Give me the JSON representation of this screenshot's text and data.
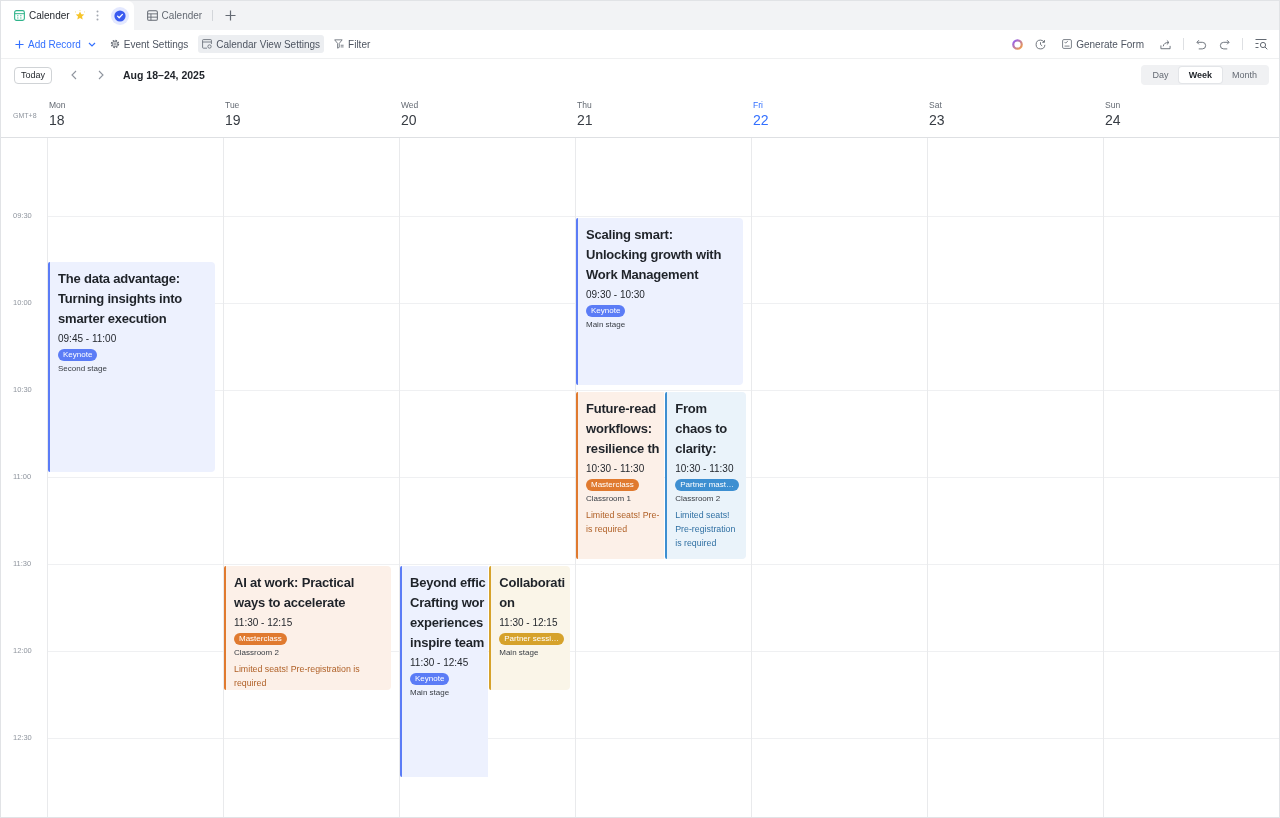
{
  "tabs": [
    {
      "label": "Calender",
      "kind": "calendar",
      "selected": true,
      "starred": true,
      "verified": true
    },
    {
      "label": "Calender",
      "kind": "grid",
      "selected": false,
      "starred": false,
      "verified": false
    }
  ],
  "toolbar": {
    "add_record": "Add Record",
    "actions": [
      {
        "label": "Event Settings",
        "kind": "gear",
        "selected": false
      },
      {
        "label": "Calendar View Settings",
        "kind": "view",
        "selected": true
      },
      {
        "label": "Filter",
        "kind": "filter",
        "selected": false
      }
    ],
    "generate_form": "Generate Form"
  },
  "nav": {
    "today": "Today",
    "range": "Aug 18–24, 2025"
  },
  "views": [
    {
      "label": "Day",
      "selected": false
    },
    {
      "label": "Week",
      "selected": true
    },
    {
      "label": "Month",
      "selected": false
    }
  ],
  "timezone": "GMT+8",
  "time_labels": [
    "09:30",
    "10:00",
    "10:30",
    "11:00",
    "11:30",
    "12:00",
    "12:30"
  ],
  "days": [
    {
      "name": "Mon",
      "date": "18",
      "today": false,
      "events": [
        {
          "title": "The data advantage: Turning insights into smarter execution",
          "time": "09:45 - 11:00",
          "tag": "Keynote",
          "color": "#5b7cf6",
          "location": "Second stage"
        }
      ]
    },
    {
      "name": "Tue",
      "date": "19",
      "today": false,
      "events": [
        {
          "title": "AI at work: Practical ways to accelerate",
          "time": "11:30 - 12:15",
          "tag": "Masterclass",
          "color": "#e07a2f",
          "location": "Classroom 2",
          "note": "Limited seats! Pre-registration is required"
        }
      ]
    },
    {
      "name": "Wed",
      "date": "20",
      "today": false,
      "events": [
        {
          "title": "Beyond effic\nCrafting wor\nexperiences\ninspire team",
          "time": "11:30 - 12:45",
          "tag": "Keynote",
          "color": "#5b7cf6",
          "location": "Main stage"
        },
        {
          "title": "Collaboration",
          "time": "11:30 - 12:15",
          "tag": "Partner sessi…",
          "color": "#d6a22b",
          "location": "Main stage"
        }
      ]
    },
    {
      "name": "Thu",
      "date": "21",
      "today": false,
      "events": [
        {
          "title": "Scaling smart: Unlocking growth with Work Management",
          "time": "09:30 - 10:30",
          "tag": "Keynote",
          "color": "#5b7cf6",
          "location": "Main stage"
        },
        {
          "title": "Future-read\nworkflows:\nresilience th",
          "time": "10:30 - 11:30",
          "tag": "Masterclass",
          "color": "#e07a2f",
          "location": "Classroom 1",
          "note": "Limited seats! Pre-\nis required"
        },
        {
          "title": "From chaos to clarity:",
          "time": "10:30 - 11:30",
          "tag": "Partner mast…",
          "color": "#3d8fd1",
          "location": "Classroom 2",
          "note": "Limited seats! Pre-registration is required"
        }
      ]
    },
    {
      "name": "Fri",
      "date": "22",
      "today": true
    },
    {
      "name": "Sat",
      "date": "23",
      "today": false
    },
    {
      "name": "Sun",
      "date": "24",
      "today": false
    }
  ]
}
